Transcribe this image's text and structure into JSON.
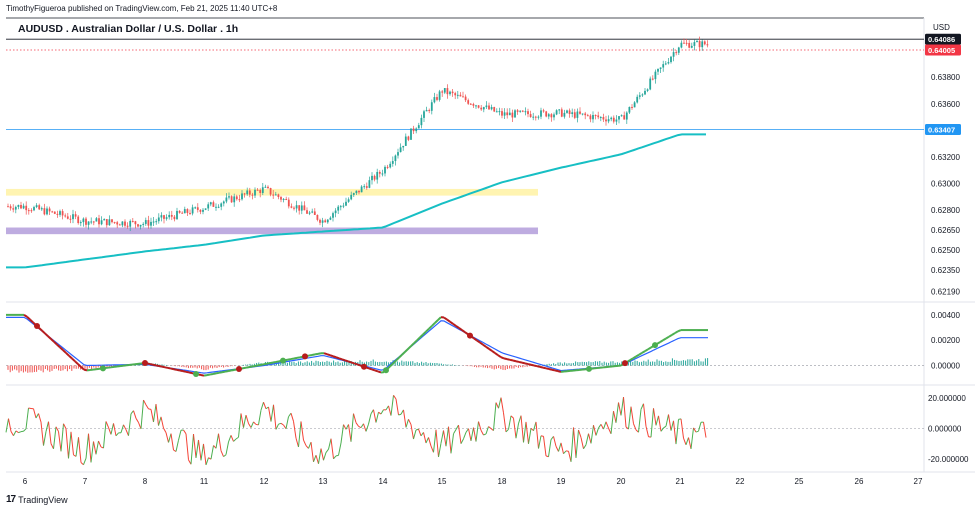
{
  "header": {
    "publisher": "TimothyFigueroa published on TradingView.com, Feb 21, 2025 11:40 UTC+8",
    "title": "AUDUSD . Australian Dollar / U.S. Dollar . 1h",
    "currency": "USD"
  },
  "footer": {
    "brand": "TradingView",
    "logo": "17"
  },
  "colors": {
    "up": "#26a69a",
    "down": "#ef5350",
    "ema": "#17bfc4",
    "zone_yellow": "#fff3a8",
    "zone_purple": "#b39ddb",
    "last_price": "#f23645",
    "level_line": "#2196f3",
    "macd_fast_up": "#4caf50",
    "macd_fast_down": "#b71c1c",
    "macd_signal": "#2962ff",
    "osc_up": "#4caf50",
    "osc_down": "#f44336"
  },
  "chart_data": [
    {
      "type": "candlestick",
      "title": "AUDUSD . Australian Dollar / U.S. Dollar . 1h",
      "x_ticks": [
        "6",
        "7",
        "8",
        "11",
        "12",
        "13",
        "14",
        "15",
        "18",
        "19",
        "20",
        "21",
        "22",
        "25",
        "26",
        "27"
      ],
      "y_ticks": [
        "0.63800",
        "0.63600",
        "0.63200",
        "0.63000",
        "0.62800",
        "0.62650",
        "0.62500",
        "0.62350",
        "0.62190"
      ],
      "ylim": [
        0.6214,
        0.6411
      ],
      "price_badges": [
        {
          "label": "0.64086",
          "value": 0.64086,
          "style": "dark"
        },
        {
          "label": "0.64005",
          "value": 0.64005,
          "style": "red"
        },
        {
          "label": "0.63407",
          "value": 0.63407,
          "style": "blue"
        }
      ],
      "horizontal_lines": [
        {
          "value": 0.64086,
          "color": "#131722",
          "style": "solid"
        },
        {
          "value": 0.64005,
          "color": "#f23645",
          "style": "dotted"
        },
        {
          "value": 0.63407,
          "color": "#2196f3",
          "style": "solid"
        }
      ],
      "zones": [
        {
          "name": "resistance-zone",
          "from": 0.6291,
          "to": 0.6296,
          "color": "#fff3a8",
          "x_start": "6",
          "x_end": "18"
        },
        {
          "name": "support-zone",
          "from": 0.6262,
          "to": 0.6267,
          "color": "#b39ddb",
          "x_start": "6",
          "x_end": "18"
        }
      ],
      "ema_line": {
        "x": [
          "6",
          "7",
          "8",
          "11",
          "12",
          "13",
          "14",
          "15",
          "18",
          "19",
          "20",
          "21"
        ],
        "y": [
          0.6237,
          0.6243,
          0.6249,
          0.6254,
          0.6261,
          0.6264,
          0.6267,
          0.6285,
          0.6301,
          0.6312,
          0.6322,
          0.6337
        ]
      },
      "price_path": {
        "x": [
          "6",
          "7",
          "8",
          "11",
          "12",
          "13",
          "14",
          "15",
          "18",
          "19",
          "20",
          "21"
        ],
        "close": [
          0.6283,
          0.6272,
          0.627,
          0.6282,
          0.6296,
          0.6272,
          0.631,
          0.637,
          0.6352,
          0.6353,
          0.6348,
          0.6405
        ]
      }
    },
    {
      "type": "line",
      "title": "",
      "y_ticks": [
        "0.00400",
        "0.00200",
        "0.00000"
      ],
      "ylim": [
        -0.0013,
        0.0047
      ],
      "x": [
        "6",
        "7",
        "8",
        "11",
        "12",
        "13",
        "14",
        "15",
        "18",
        "19",
        "20",
        "21"
      ],
      "series": [
        {
          "values": [
            0.004,
            -0.0004,
            0.0002,
            -0.0008,
            0.0001,
            0.001,
            -0.0006,
            0.0039,
            0.0006,
            -0.0005,
            0.0,
            0.0028
          ]
        },
        {
          "values": [
            0.0038,
            0.0,
            0.0001,
            -0.0006,
            0.0,
            0.0008,
            -0.0004,
            0.0036,
            0.001,
            -0.0004,
            0.0,
            0.0022
          ]
        }
      ],
      "histogram": [
        -0.0006,
        -0.0004,
        0.0003,
        -0.0004,
        0.0003,
        0.0004,
        0.0005,
        0.0002,
        -0.0004,
        0.0003,
        0.0004,
        0.0006
      ]
    },
    {
      "type": "line",
      "title": "",
      "y_ticks": [
        "20.000000",
        "0.000000",
        "-20.000000"
      ],
      "ylim": [
        -26,
        26
      ],
      "x": [
        "6",
        "7",
        "8",
        "11",
        "12",
        "13",
        "14",
        "15",
        "18",
        "19",
        "20",
        "21"
      ],
      "series": [
        {
          "values": [
            5,
            -14,
            12,
            -20,
            14,
            -18,
            16,
            -12,
            10,
            -16,
            12,
            -4
          ]
        }
      ]
    }
  ]
}
